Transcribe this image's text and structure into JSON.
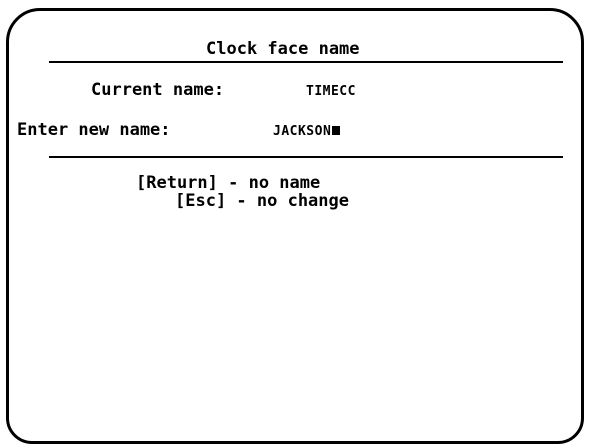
{
  "dialog": {
    "title": "Clock face name",
    "current_name_label": "Current name:",
    "current_name_value": "TIMECC",
    "new_name_label": "Enter new name:",
    "new_name_value": "JACKSON",
    "hint_return": "[Return] - no name",
    "hint_esc": "[Esc] - no change"
  }
}
